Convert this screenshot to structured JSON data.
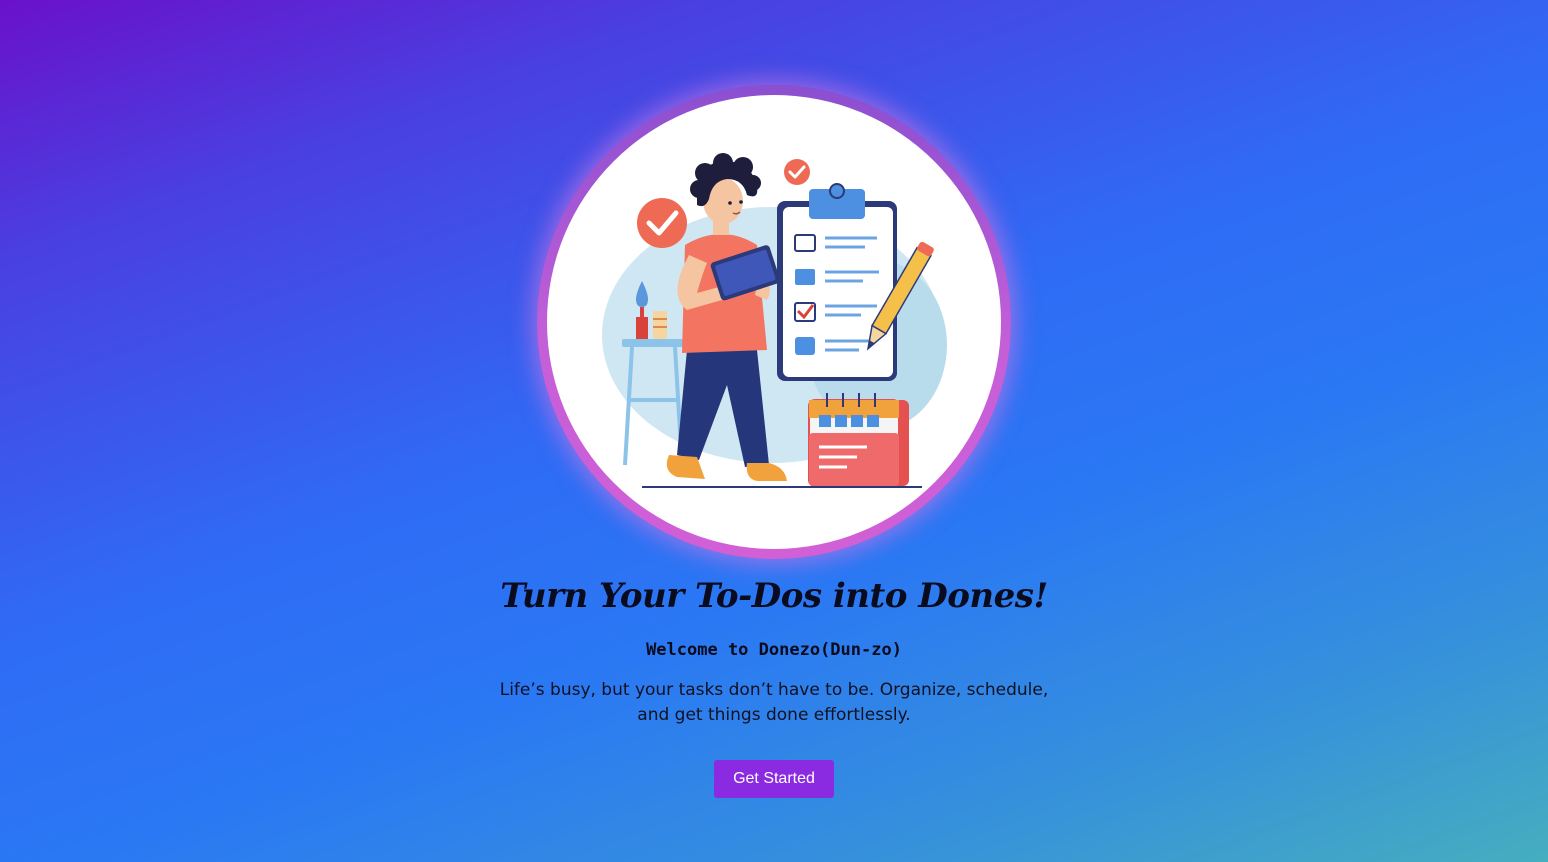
{
  "hero": {
    "title": "Turn Your To-Dos into Dones!",
    "subtitle": "Welcome to Donezo(Dun-zo)",
    "description": "Life’s busy, but your tasks don’t have to be. Organize, schedule, and get things done effortlessly.",
    "cta_label": "Get Started"
  },
  "colors": {
    "background_gradient": [
      "#6a11cb",
      "#2a78f4",
      "#45aebf"
    ],
    "circle_ring": "#c45fd8",
    "cta_button": "#8a2be2",
    "text_dark": "#0b0b1e"
  },
  "illustration": {
    "icon": "person-with-checklist-illustration"
  }
}
